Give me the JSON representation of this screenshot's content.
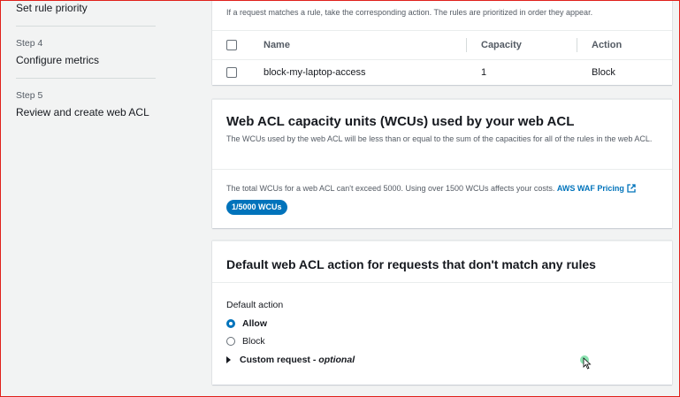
{
  "sidebar": {
    "steps": [
      {
        "num": "",
        "title": "Set rule priority"
      },
      {
        "num": "Step 4",
        "title": "Configure metrics"
      },
      {
        "num": "Step 5",
        "title": "Review and create web ACL"
      }
    ]
  },
  "rules_panel": {
    "hint": "If a request matches a rule, take the corresponding action. The rules are prioritized in order they appear.",
    "columns": [
      "Name",
      "Capacity",
      "Action"
    ],
    "rows": [
      {
        "name": "block-my-laptop-access",
        "capacity": "1",
        "action": "Block"
      }
    ]
  },
  "wcu_panel": {
    "title": "Web ACL capacity units (WCUs) used by your web ACL",
    "description": "The WCUs used by the web ACL will be less than or equal to the sum of the capacities for all of the rules in the web ACL.",
    "limit_text": "The total WCUs for a web ACL can't exceed 5000. Using over 1500 WCUs affects your costs.",
    "pricing_link": "AWS WAF Pricing",
    "badge": "1/5000 WCUs"
  },
  "default_action_panel": {
    "title": "Default web ACL action for requests that don't match any rules",
    "label": "Default action",
    "options": [
      {
        "label": "Allow",
        "selected": true
      },
      {
        "label": "Block",
        "selected": false
      }
    ],
    "expander": {
      "label": "Custom request",
      "dash": " - ",
      "optional": "optional"
    }
  },
  "colors": {
    "accent": "#0073bb",
    "frame": "#e0201b"
  },
  "icons": [
    "external-link-icon",
    "caret-right-icon",
    "cursor-icon"
  ]
}
